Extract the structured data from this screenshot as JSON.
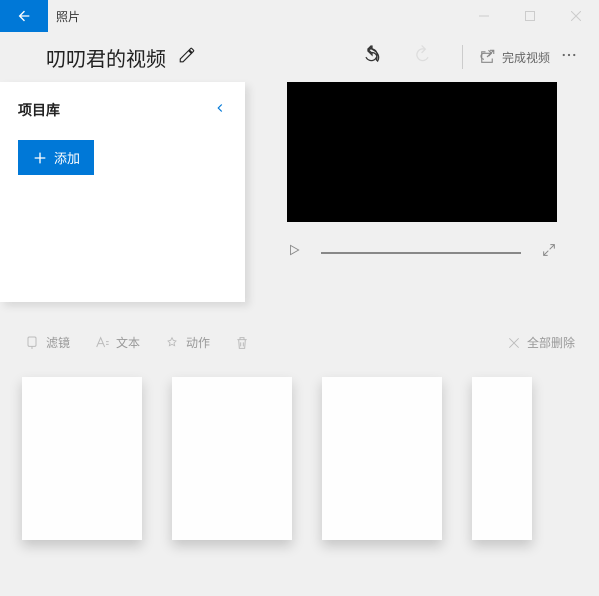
{
  "app": {
    "title": "照片"
  },
  "header": {
    "project_title": "叨叨君的视频",
    "finish_label": "完成视频"
  },
  "library": {
    "title": "项目库",
    "add_label": "添加"
  },
  "toolbar": {
    "filter_label": "滤镜",
    "text_label": "文本",
    "motion_label": "动作",
    "delete_all_label": "全部删除"
  }
}
